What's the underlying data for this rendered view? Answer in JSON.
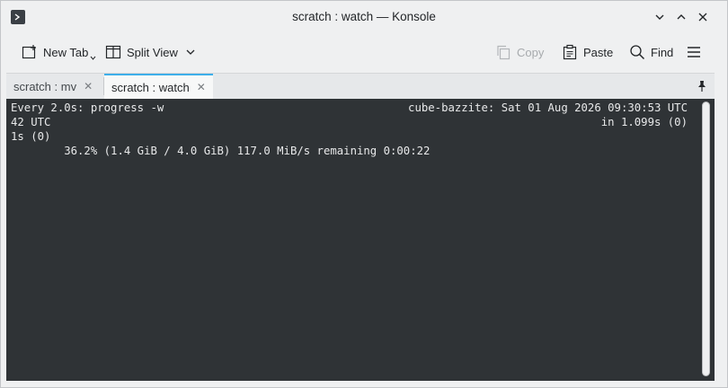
{
  "window": {
    "title": "scratch : watch — Konsole"
  },
  "toolbar": {
    "new_tab": "New Tab",
    "split_view": "Split View",
    "copy": "Copy",
    "paste": "Paste",
    "find": "Find"
  },
  "tabs": [
    {
      "label": "scratch : mv",
      "active": false
    },
    {
      "label": "scratch : watch",
      "active": true
    }
  ],
  "terminal": {
    "line1_left": "Every 2.0s: progress -w",
    "line1_right": "cube-bazzite: Sat 01 Aug 2026 09:30:53 UTC",
    "line2_left": "42 UTC",
    "line2_right": "in 1.099s (0)",
    "line3": "1s (0)",
    "line4": "        36.2% (1.4 GiB / 4.0 GiB) 117.0 MiB/s remaining 0:00:22"
  },
  "colors": {
    "terminal_bg": "#2f3336",
    "terminal_fg": "#e8e9ea",
    "accent": "#3daee9"
  }
}
